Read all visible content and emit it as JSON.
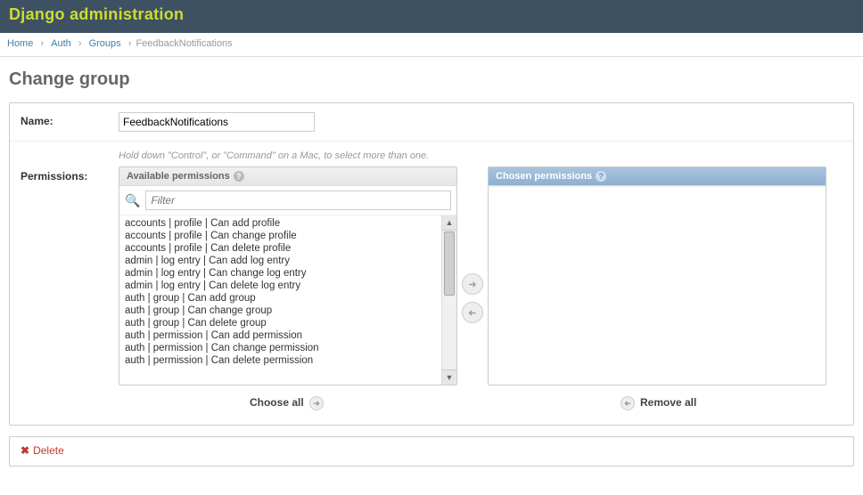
{
  "header": {
    "site_title": "Django administration"
  },
  "breadcrumbs": {
    "items": [
      "Home",
      "Auth",
      "Groups"
    ],
    "current": "FeedbackNotifications"
  },
  "page": {
    "title": "Change group"
  },
  "form": {
    "name_label": "Name:",
    "name_value": "FeedbackNotifications",
    "perm_label": "Permissions:",
    "perm_help": "Hold down \"Control\", or \"Command\" on a Mac, to select more than one."
  },
  "selector": {
    "available_header": "Available permissions",
    "chosen_header": "Chosen permissions",
    "filter_placeholder": "Filter",
    "choose_all": "Choose all",
    "remove_all": "Remove all",
    "available": [
      "accounts | profile | Can add profile",
      "accounts | profile | Can change profile",
      "accounts | profile | Can delete profile",
      "admin | log entry | Can add log entry",
      "admin | log entry | Can change log entry",
      "admin | log entry | Can delete log entry",
      "auth | group | Can add group",
      "auth | group | Can change group",
      "auth | group | Can delete group",
      "auth | permission | Can add permission",
      "auth | permission | Can change permission",
      "auth | permission | Can delete permission"
    ],
    "chosen": []
  },
  "actions": {
    "delete": "Delete"
  }
}
